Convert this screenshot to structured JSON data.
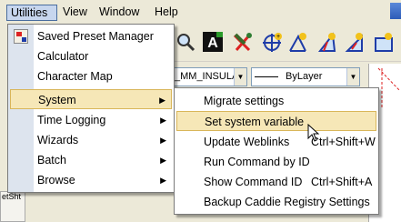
{
  "menubar": {
    "items": [
      {
        "label": "Utilities",
        "active": true
      },
      {
        "label": "View"
      },
      {
        "label": "Window"
      },
      {
        "label": "Help"
      }
    ]
  },
  "toolbar": {
    "linetype_value": "_MM_INSULA",
    "lineweight_value": "ByLayer",
    "icons": [
      "zoom-icon",
      "text-style-icon",
      "tools-icon",
      "target-icon",
      "draw-icon",
      "triangle-icon",
      "triangle-add-icon",
      "shape-icon"
    ]
  },
  "side": {
    "set_sheet_label": "etSht"
  },
  "utilities_menu": {
    "items": [
      {
        "label": "Saved Preset Manager",
        "icon": "preset-manager-icon"
      },
      {
        "label": "Calculator"
      },
      {
        "label": "Character Map"
      },
      {
        "label": "System",
        "submenu": true,
        "highlighted": true
      },
      {
        "label": "Time Logging",
        "submenu": true
      },
      {
        "label": "Wizards",
        "submenu": true
      },
      {
        "label": "Batch",
        "submenu": true
      },
      {
        "label": "Browse",
        "submenu": true
      }
    ]
  },
  "system_submenu": {
    "items": [
      {
        "label": "Migrate settings",
        "shortcut": ""
      },
      {
        "label": "Set system variable",
        "shortcut": "",
        "highlighted": true
      },
      {
        "label": "Update Weblinks",
        "shortcut": "Ctrl+Shift+W"
      },
      {
        "label": "Run Command by ID",
        "shortcut": ""
      },
      {
        "label": "Show Command ID",
        "shortcut": "Ctrl+Shift+A"
      },
      {
        "label": "Backup Caddie Registry Settings",
        "shortcut": ""
      }
    ]
  },
  "colors": {
    "highlight": "#f6e7b7",
    "highlight_border": "#d9b65a",
    "menu_border": "#7a7a7a",
    "gutter": "#dde4ee",
    "active_menu": "#c7d6ee"
  }
}
